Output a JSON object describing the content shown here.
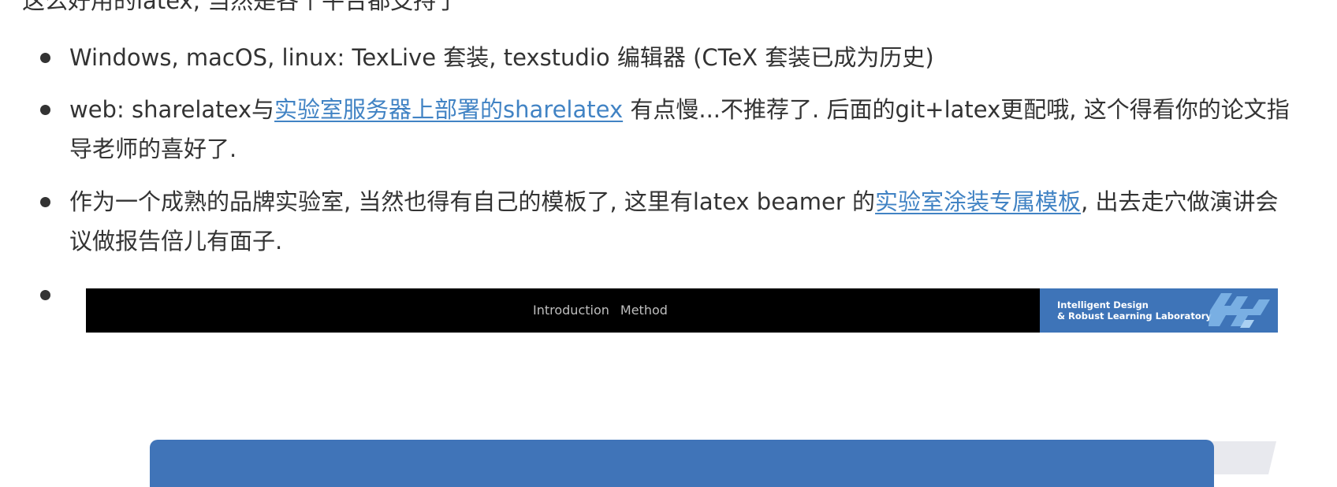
{
  "intro_text": "这么好用的latex, 当然是各个平台都支持了",
  "items": [
    {
      "text": "Windows, macOS, linux: TexLive 套装, texstudio 编辑器 (CTeX 套装已成为历史)"
    },
    {
      "prefix": "web: sharelatex与",
      "link": "实验室服务器上部署的sharelatex",
      "suffix": " 有点慢...不推荐了. 后面的git+latex更配哦, 这个得看你的论文指导老师的喜好了."
    },
    {
      "prefix": "作为一个成熟的品牌实验室, 当然也得有自己的模板了, 这里有latex beamer 的",
      "link": "实验室涂装专属模板",
      "suffix": ", 出去走穴做演讲会议做报告倍儿有面子."
    }
  ],
  "slide_preview": {
    "nav_items": [
      "Introduction",
      "Method"
    ],
    "lab_name_line1": "Intelligent Design",
    "lab_name_line2": "& Robust Learning Laboratory",
    "logo_icon": "lab-logo-icon",
    "colors": {
      "header_bg": "#000000",
      "lab_block_bg": "#3e74b8",
      "logo_color": "#7fb6e8",
      "body_bg": "#4074b8",
      "link_color": "#4183c4"
    }
  }
}
